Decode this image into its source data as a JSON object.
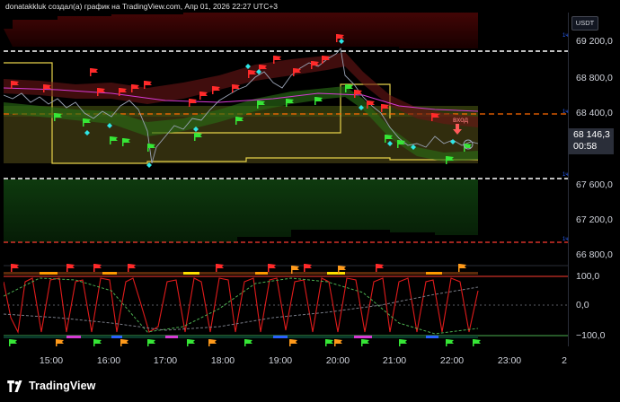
{
  "header": {
    "title": "donatakkluk создал(а) график на TradingView.com, Апр 01, 2026 22:27 UTC+3"
  },
  "price_axis": {
    "currency": "USDT",
    "ticks": [
      "69 200,0",
      "68 800,0",
      "68 400,0",
      "67 600,0",
      "67 200,0",
      "66 800,0"
    ],
    "last_price": "68 146,3",
    "countdown": "00:58"
  },
  "indicator_axis": {
    "ticks": [
      "100,0",
      "0,0",
      "−100,0"
    ]
  },
  "time_axis": {
    "ticks": [
      "15:00",
      "16:00",
      "17:00",
      "18:00",
      "19:00",
      "20:00",
      "21:00",
      "22:00",
      "23:00",
      "2"
    ]
  },
  "annotations": {
    "entry_label": "вход",
    "level_tag": "1ч"
  },
  "footer": {
    "brand": "TradingView"
  },
  "colors": {
    "background": "#000000",
    "upper_band": "#5a0a0a",
    "lower_band": "#0f3a10",
    "yellow_level": "#e6d14a",
    "red_dashed": "#ff3b30",
    "white_dashed": "#ffffff",
    "orange_dashed": "#ff6a00",
    "oscillator": "#e01b1b",
    "green_dashed": "#4caf50"
  },
  "icons": [
    "red-flag-icon",
    "green-flag-icon",
    "orange-flag-icon",
    "cyan-diamond-icon",
    "tradingview-logo-icon"
  ]
}
